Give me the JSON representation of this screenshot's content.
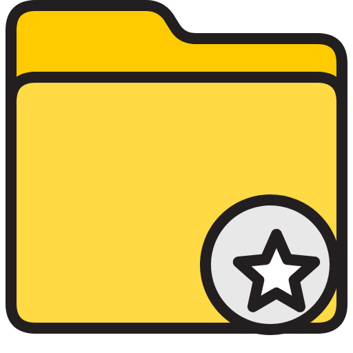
{
  "icon": {
    "name": "favorite-folder-icon",
    "colors": {
      "outline": "#231F20",
      "folder_back": "#FFCB00",
      "folder_front": "#FFDA44",
      "badge_fill": "#E8E8E8",
      "star_fill": "#FFFFFF"
    }
  }
}
